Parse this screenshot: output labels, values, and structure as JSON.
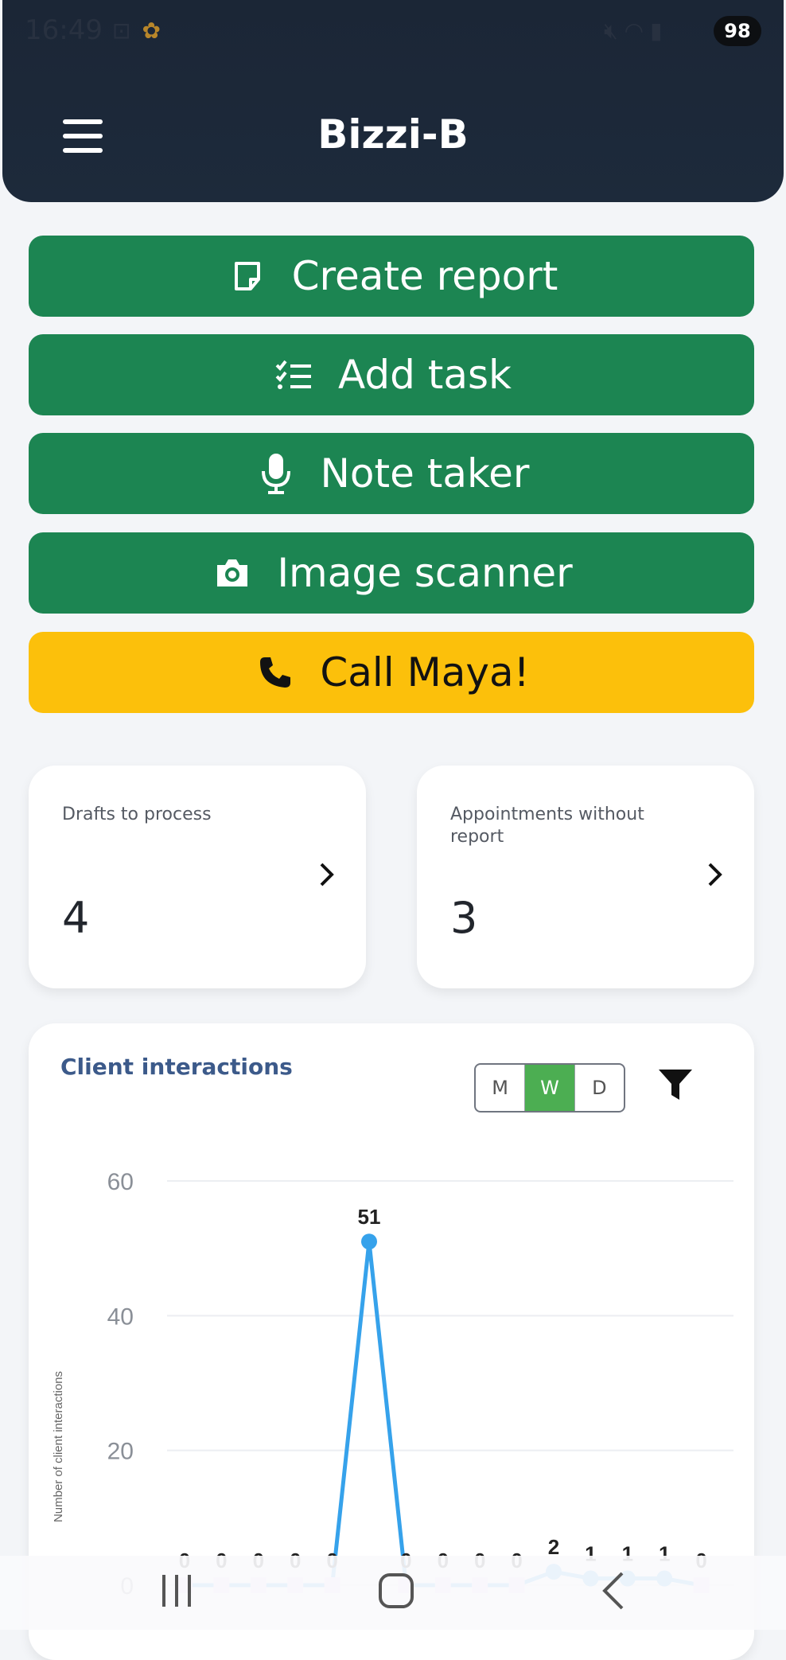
{
  "status_bar": {
    "time": "16:49",
    "battery": "98",
    "left_icons": [
      "screenshot-icon",
      "app-notification-icon"
    ],
    "right_icons": [
      "mute-icon",
      "wifi-icon",
      "signal-icon"
    ]
  },
  "header": {
    "title": "Bizzi-B",
    "menu_icon": "hamburger-menu-icon"
  },
  "actions": [
    {
      "label": "Create report",
      "icon": "note-icon",
      "color": "#1c8552"
    },
    {
      "label": "Add task",
      "icon": "checklist-icon",
      "color": "#1c8552"
    },
    {
      "label": "Note taker",
      "icon": "microphone-icon",
      "color": "#1c8552"
    },
    {
      "label": "Image scanner",
      "icon": "camera-icon",
      "color": "#1c8552"
    },
    {
      "label": "Call Maya!",
      "icon": "phone-icon",
      "color": "#fcc00b"
    }
  ],
  "cards": [
    {
      "label": "Drafts to process",
      "value": "4"
    },
    {
      "label": "Appointments without report",
      "value": "3"
    }
  ],
  "chart_section": {
    "title": "Client interactions",
    "toggles": [
      "M",
      "W",
      "D"
    ],
    "active_toggle": "W",
    "filter_icon": "filter-icon"
  },
  "chart_data": {
    "type": "line",
    "ylabel": "Number of client interactions",
    "ylim": [
      0,
      60
    ],
    "yticks": [
      0,
      20,
      40,
      60
    ],
    "grid": true,
    "series": [
      {
        "color": "#36a2eb",
        "values": [
          0,
          0,
          0,
          0,
          0,
          51,
          0,
          0,
          0,
          0,
          2,
          1,
          1,
          1,
          0
        ]
      }
    ]
  },
  "nav_bar": {
    "buttons": [
      "recent-apps-icon",
      "home-icon",
      "back-icon"
    ]
  }
}
